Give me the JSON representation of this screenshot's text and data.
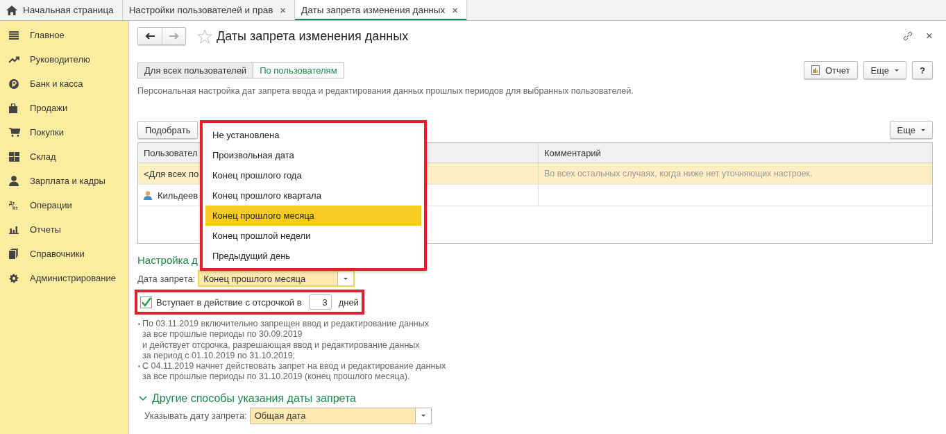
{
  "tabs": [
    {
      "kind": "home",
      "label": "Начальная страница",
      "selected": false
    },
    {
      "kind": "page",
      "label": "Настройки пользователей и прав",
      "close": "×",
      "selected": false
    },
    {
      "kind": "page",
      "label": "Даты запрета изменения данных",
      "close": "×",
      "selected": true
    }
  ],
  "sidebar": {
    "items": [
      {
        "kind": "menu",
        "label": "Главное"
      },
      {
        "kind": "trend",
        "label": "Руководителю"
      },
      {
        "kind": "ruble",
        "label": "Банк и касса"
      },
      {
        "kind": "bag",
        "label": "Продажи"
      },
      {
        "kind": "cart",
        "label": "Покупки"
      },
      {
        "kind": "grid",
        "label": "Склад"
      },
      {
        "kind": "person",
        "label": "Зарплата и кадры"
      },
      {
        "kind": "dtkt",
        "label": "Операции",
        "icon_top": "Дт",
        "icon_bottom": "Кт"
      },
      {
        "kind": "bars",
        "label": "Отчеты"
      },
      {
        "kind": "books",
        "label": "Справочники"
      },
      {
        "kind": "gear",
        "label": "Администрирование"
      }
    ]
  },
  "form": {
    "title": "Даты запрета изменения данных",
    "close": "×",
    "mode_buttons": [
      {
        "label": "Для всех пользователей",
        "selected": false
      },
      {
        "label": "По пользователям",
        "selected": true
      }
    ],
    "toolbar": [
      {
        "kind": "report",
        "label": "Отчет"
      },
      {
        "kind": "more",
        "label": "Еще"
      },
      {
        "kind": "help",
        "label": "?"
      }
    ],
    "description": "Персональная настройка дат запрета ввода и редактирования данных прошлых периодов для выбранных пользователей.",
    "table_toolbar": {
      "pick": "Подобрать",
      "more": "Еще"
    },
    "table": {
      "columns": [
        "Пользовател",
        "Комментарий"
      ],
      "rows": [
        {
          "user": "<Для всех по",
          "comment": "Во всех остальных случаях, когда ниже нет уточняющих настроек.",
          "kind": "all",
          "selected": true
        },
        {
          "user": "Кильдеев",
          "comment": "",
          "kind": "person",
          "selected": false
        }
      ]
    },
    "section_title": "Настройка д",
    "date_field": {
      "label": "Дата запрета:",
      "value": "Конец прошлого месяца"
    },
    "dropdown": {
      "highlighted": true,
      "options": [
        {
          "label": "Не установлена",
          "selected": false
        },
        {
          "label": "Произвольная дата",
          "selected": false
        },
        {
          "label": "Конец прошлого года",
          "selected": false
        },
        {
          "label": "Конец прошлого квартала",
          "selected": false
        },
        {
          "label": "Конец прошлого месяца",
          "selected": true
        },
        {
          "label": "Конец прошлой недели",
          "selected": false
        },
        {
          "label": "Предыдущий день",
          "selected": false
        }
      ]
    },
    "delay": {
      "highlighted": true,
      "checked": true,
      "label": "Вступает в действие с отсрочкой в",
      "value": "3",
      "unit": "дней"
    },
    "notes": [
      [
        "По 03.11.2019 включительно запрещен ввод и редактирование данных",
        "за все прошлые периоды по 30.09.2019",
        "и действует отсрочка, разрешающая ввод и редактирование данных",
        "за период с 01.10.2019 по 31.10.2019;"
      ],
      [
        "С 04.11.2019 начнет действовать запрет на ввод и редактирование данных",
        "за все прошлые периоды по 31.10.2019 (конец прошлого месяца)."
      ]
    ],
    "other": {
      "title": "Другие способы указания даты запрета",
      "expanded": true,
      "label": "Указывать дату запрета:",
      "value": "Общая дата"
    }
  }
}
